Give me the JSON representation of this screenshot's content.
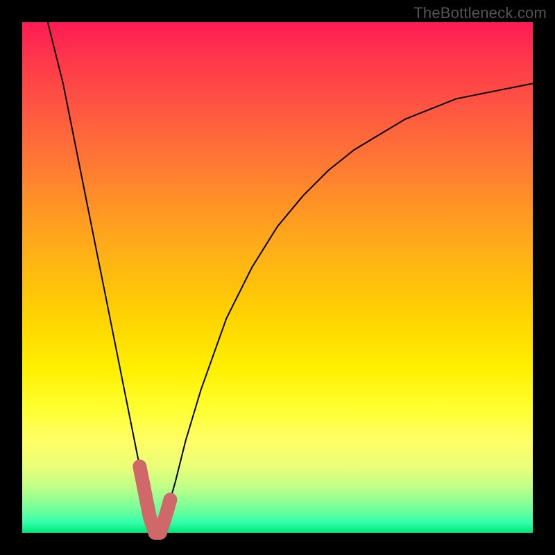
{
  "watermark": "TheBottleneck.com",
  "chart_data": {
    "type": "line",
    "title": "",
    "xlabel": "",
    "ylabel": "",
    "xlim": [
      0,
      100
    ],
    "ylim": [
      0,
      100
    ],
    "grid": false,
    "legend": false,
    "series": [
      {
        "name": "bottleneck-curve",
        "x": [
          5,
          8,
          10,
          12,
          14,
          16,
          18,
          20,
          22,
          24,
          25,
          26,
          27,
          28,
          30,
          32,
          35,
          40,
          45,
          50,
          55,
          60,
          65,
          70,
          75,
          80,
          85,
          90,
          95,
          100
        ],
        "y": [
          100,
          88,
          78,
          68,
          58,
          48,
          38,
          28,
          18,
          8,
          3,
          0,
          0,
          3,
          10,
          18,
          28,
          42,
          52,
          60,
          66,
          71,
          75,
          78,
          81,
          83,
          85,
          86,
          87,
          88
        ]
      }
    ],
    "highlight_range": {
      "x_start": 23,
      "x_end": 29,
      "description": "optimal-region"
    },
    "colors": {
      "curve": "#000000",
      "highlight": "#d0686a",
      "gradient_top": "#ff1a55",
      "gradient_bottom": "#00e676"
    }
  }
}
